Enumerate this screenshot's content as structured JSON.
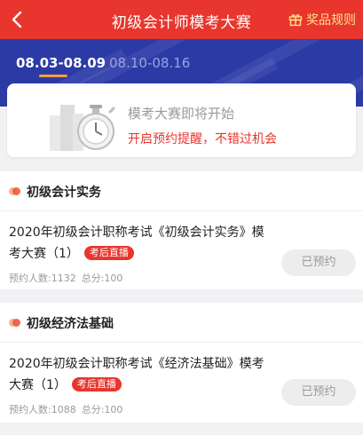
{
  "nav": {
    "title": "初级会计师模考大赛",
    "rules_label": "奖品规则"
  },
  "tabs": [
    {
      "label": "08.03-08.09",
      "active": true
    },
    {
      "label": "08.10-08.16",
      "active": false
    }
  ],
  "banner": {
    "title": "模考大赛即将开始",
    "subtitle": "开启预约提醒，不错过机会"
  },
  "sections": [
    {
      "heading": "初级会计实务",
      "exam_title": "2020年初级会计职称考试《初级会计实务》模考大赛（1）",
      "tag": "考后直播",
      "reserve_count": "预约人数:1132",
      "total_score": "总分:100",
      "button": "已预约"
    },
    {
      "heading": "初级经济法基础",
      "exam_title": "2020年初级会计职称考试《经济法基础》模考大赛（1）",
      "tag": "考后直播",
      "reserve_count": "预约人数:1088",
      "total_score": "总分:100",
      "button": "已预约"
    }
  ],
  "colors": {
    "brand_red": "#e8352d",
    "hero_blue": "#2c3aa6",
    "tab_underline": "#f4a13a"
  }
}
